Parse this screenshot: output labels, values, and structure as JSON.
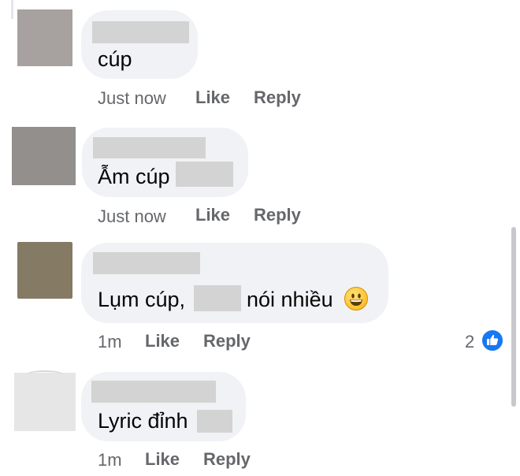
{
  "colors": {
    "bubble_bg": "#f0f2f5",
    "meta_text": "#65676b",
    "like_blue": "#1877f2",
    "redaction": "#d3d3d3"
  },
  "comments": [
    {
      "text": "cúp",
      "timestamp": "Just now",
      "like_label": "Like",
      "reply_label": "Reply"
    },
    {
      "text": "Ẫm cúp",
      "timestamp": "Just now",
      "like_label": "Like",
      "reply_label": "Reply"
    },
    {
      "text_before": "Lụm cúp,",
      "text_after": "nói nhiều",
      "emoji": "grinning-face",
      "timestamp": "1m",
      "like_label": "Like",
      "reply_label": "Reply",
      "reaction_count": "2",
      "reaction_icon": "thumbs-up-icon"
    },
    {
      "text": "Lyric đỉnh",
      "timestamp": "1m",
      "like_label": "Like",
      "reply_label": "Reply"
    }
  ]
}
